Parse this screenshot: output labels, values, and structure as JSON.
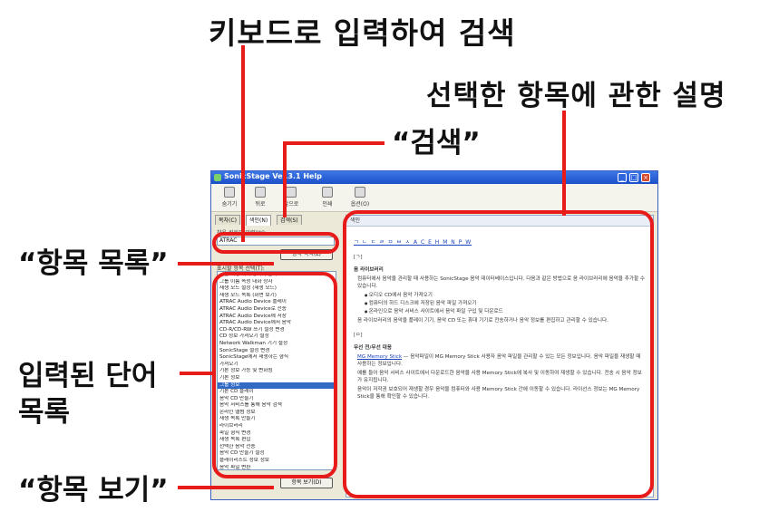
{
  "annotations": {
    "search_by_keyboard": "키보드로 입력하여 검색",
    "description": "선택한 항목에 관한 설명",
    "search": "“검색”",
    "item_list": "“항목 목록”",
    "entered_words_list": "입력된 단어 목록",
    "view_item": "“항목 보기”"
  },
  "window": {
    "title": "SonicStage Ver.3.1 Help",
    "controls": {
      "minimize": "_",
      "maximize": "□",
      "close": "×"
    },
    "toolbar": [
      "숨기기",
      "뒤로",
      "앞으로",
      "인쇄",
      "옵션(O)"
    ],
    "tabs": [
      "목차(C)",
      "색인(N)",
      "검색(S)"
    ],
    "keyword_label": "찾을 키워드 입력(W):",
    "keyword_value": "ATRAC",
    "show_list_button": "항목 목록(L)",
    "list_heading": "표시할 항목 선택(T):",
    "word_list": [
      "그룹 속성 대화 상자의 음악...",
      "그룹 이름 속성 대화 상자",
      "재생 모드 설정 (재생 모드)",
      "재생 모드 목록 (화면 보기)",
      "ATRAC Audio Device 플레이",
      "ATRAC Audio Device로 전송",
      "ATRAC Audio Device에 저장",
      "ATRAC Audio Device에서 음악",
      "CD-R/CD-RW 쓰기 설정 변경",
      "CD 정보 가져오기 설정",
      "Network Walkman 기기 설정",
      "SonicStage 설정 변경",
      "SonicStage에서 재생하는 형식",
      "가져오기",
      "기본 정보 가능 및 변화됨",
      "기본 정보",
      "그룹 정보",
      "기본 CD 플레이",
      "음악 CD 만들기",
      "음악 서비스를 통해 음악 검색",
      "온라인 앨범 정보",
      "재생 목록 만들기",
      "라이브러리",
      "파일 형식 변경",
      "재생 목록 편집",
      "선택한 음악 전송",
      "음악 CD 만들기 설정",
      "플레이리스트 정보 정보",
      "음악 파일 변환",
      "음악 정보 편집"
    ],
    "selected_index": 16,
    "view_item_button": "항목 보기(D)",
    "content": {
      "header": "색인",
      "alpha_index": "ㄱ ㄴ ㄷ ㄹ ㅁ ㅂ ㅅ A C E H M N P W",
      "section1_mark": "[ㄱ]",
      "section1_title": "음 라이브러리",
      "section1_text": "컴퓨터에서 음악을 관리할 때 사용하는 SonicStage 음악 데이터베이스입니다. 다음과 같은 방법으로 음 라이브러리에 음악을 추가할 수 있습니다.",
      "bullets": [
        "오디오 CD에서 음악 가져오기",
        "컴퓨터의 하드 디스크에 저장된 음악 파일 가져오기",
        "온라인으로 음악 서비스 사이트에서 음악 파일 구입 및 다운로드"
      ],
      "section1_note": "음 라이브러리의 음악을 플레이 기기, 음악 CD 또는 휴대 기기로 전송하거나 음악 정보를 편집하고 관리할 수 있습니다.",
      "section2_mark": "[ㅁ]",
      "section2_title": "무선 전/무선 대응",
      "section2_text": "음악파일이 MG Memory Stick 사용자 음악 파일을 관리할 수 있는 모든 정보입니다. 음악 파일을 재생할 때 사용하는 정보입니다.",
      "section2_link": "MG Memory Stick",
      "section2_p2": "예를 들어 음악 서비스 사이트에서 다운로드한 음악을 사용 Memory Stick에 복사 및 이동하여 재생할 수 있습니다. 전송 시 음악 정보가 유지됩니다.",
      "section2_p3": "음악이 저작권 보호되어 재생할 경우 음악을 컴퓨터와 사용 Memory Stick 간에 이동할 수 있습니다. 라이선스 정보는 MG Memory Stick을 통해 확인할 수 있습니다."
    }
  }
}
